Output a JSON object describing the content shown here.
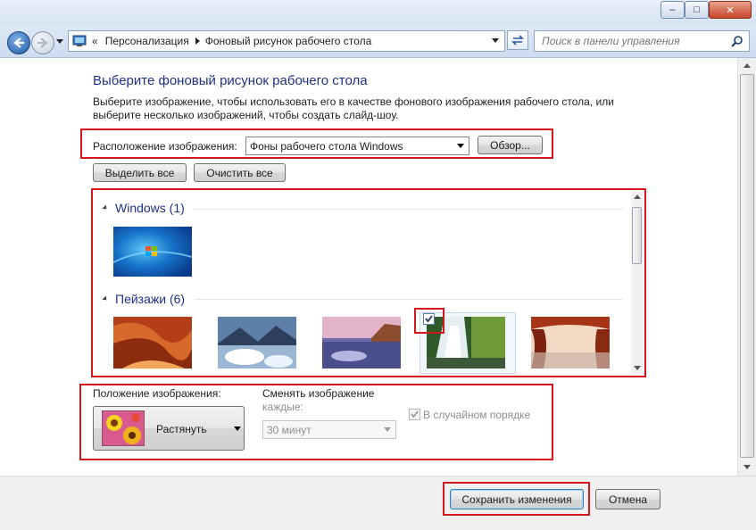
{
  "window": {
    "minimize_symbol": "–",
    "maximize_symbol": "□",
    "close_symbol": "✕"
  },
  "nav": {
    "breadcrumb_sep": "«",
    "crumbs": [
      "Персонализация",
      "Фоновый рисунок рабочего стола"
    ],
    "search_placeholder": "Поиск в панели управления"
  },
  "main": {
    "title": "Выберите фоновый рисунок рабочего стола",
    "description": "Выберите изображение, чтобы использовать его в качестве фонового изображения рабочего стола, или выберите несколько изображений, чтобы создать слайд-шоу.",
    "location_label": "Расположение изображения:",
    "location_value": "Фоны рабочего стола Windows",
    "browse_label": "Обзор...",
    "select_all_label": "Выделить все",
    "clear_all_label": "Очистить все"
  },
  "gallery": {
    "groups": [
      {
        "title": "Windows (1)",
        "thumbs": 1
      },
      {
        "title": "Пейзажи (6)",
        "thumbs": 6
      }
    ],
    "checked_index": 3
  },
  "settings": {
    "position_label": "Положение изображения:",
    "position_value": "Растянуть",
    "change_label_line1": "Сменять изображение",
    "change_label_line2": "каждые:",
    "interval_value": "30 минут",
    "shuffle_label": "В случайном порядке",
    "shuffle_checked": true
  },
  "footer": {
    "save_label": "Сохранить изменения",
    "cancel_label": "Отмена"
  },
  "colors": {
    "accent_title": "#1e3287",
    "highlight_red": "#d2181c"
  }
}
